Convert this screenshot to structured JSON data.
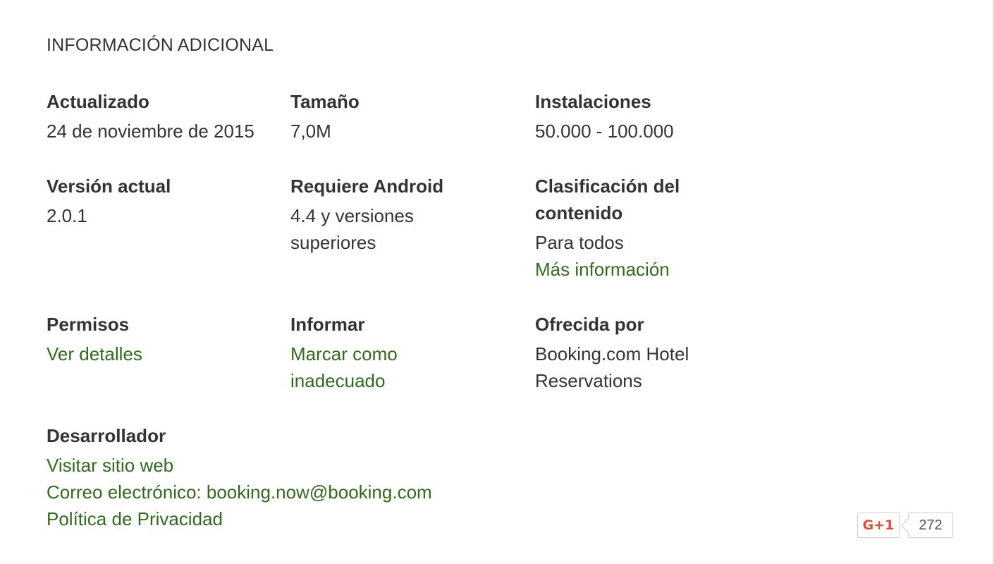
{
  "section_title": "INFORMACIÓN ADICIONAL",
  "updated": {
    "label": "Actualizado",
    "value": "24 de noviembre de 2015"
  },
  "size": {
    "label": "Tamaño",
    "value": "7,0M"
  },
  "installs": {
    "label": "Instalaciones",
    "value": "50.000 - 100.000"
  },
  "current_version": {
    "label": "Versión actual",
    "value": "2.0.1"
  },
  "requires_android": {
    "label": "Requiere Android",
    "value": "4.4 y versiones superiores"
  },
  "content_rating": {
    "label": "Clasificación del contenido",
    "value": "Para todos",
    "link": "Más información"
  },
  "permissions": {
    "label": "Permisos",
    "link": "Ver detalles"
  },
  "report": {
    "label": "Informar",
    "link": "Marcar como inadecuado"
  },
  "offered_by": {
    "label": "Ofrecida por",
    "value": "Booking.com Hotel Reservations"
  },
  "developer": {
    "label": "Desarrollador",
    "website_link": "Visitar sitio web",
    "email_link": "Correo electrónico: booking.now@booking.com",
    "privacy_link": "Política de Privacidad"
  },
  "gplus": {
    "button_label": "G+1",
    "count": "272",
    "brand_color": "#dd4b39"
  },
  "link_color": "#33691e"
}
